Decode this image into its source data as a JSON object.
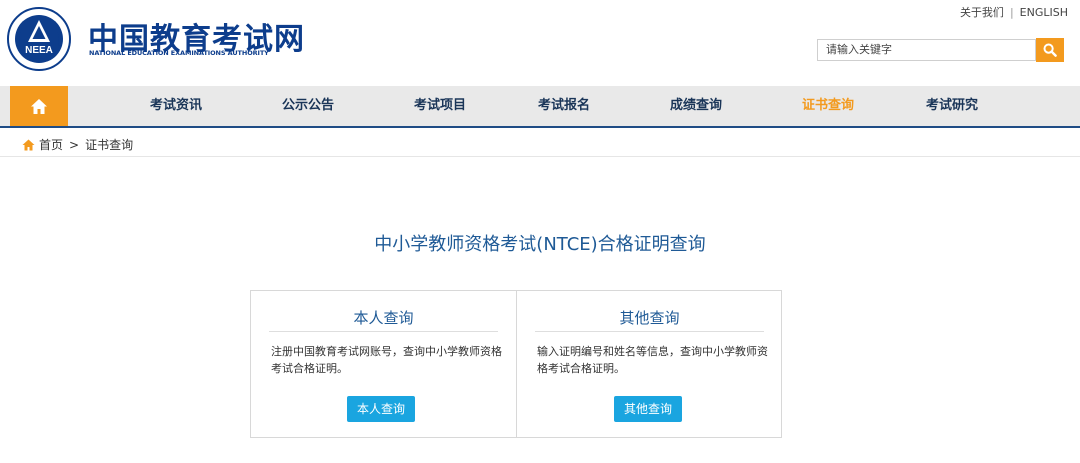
{
  "header": {
    "logo_cn": "中国教育考试网",
    "logo_en": "NATIONAL EDUCATION EXAMINATIONS AUTHORITY",
    "emblem_text": "NEEA",
    "toplinks": {
      "about": "关于我们",
      "separator": "|",
      "english": "ENGLISH"
    },
    "search": {
      "placeholder": "请输入关键字",
      "icon": "search-icon"
    }
  },
  "nav": {
    "home_icon": "home-icon",
    "items": [
      {
        "label": "考试资讯",
        "active": false
      },
      {
        "label": "公示公告",
        "active": false
      },
      {
        "label": "考试项目",
        "active": false
      },
      {
        "label": "考试报名",
        "active": false
      },
      {
        "label": "成绩查询",
        "active": false
      },
      {
        "label": "证书查询",
        "active": true
      },
      {
        "label": "考试研究",
        "active": false
      }
    ]
  },
  "breadcrumb": {
    "home": "首页",
    "separator": ">",
    "current": "证书查询"
  },
  "main": {
    "title": "中小学教师资格考试(NTCE)合格证明查询",
    "cards": [
      {
        "title": "本人查询",
        "desc": "注册中国教育考试网账号，查询中小学教师资格考试合格证明。",
        "button": "本人查询"
      },
      {
        "title": "其他查询",
        "desc": "输入证明编号和姓名等信息，查询中小学教师资格考试合格证明。",
        "button": "其他查询"
      }
    ]
  },
  "colors": {
    "brand_blue": "#0d3d8c",
    "accent_orange": "#f39a1e",
    "nav_bg": "#e9e9e9",
    "title_blue": "#1f5a96",
    "button_blue": "#1aa5e0"
  }
}
